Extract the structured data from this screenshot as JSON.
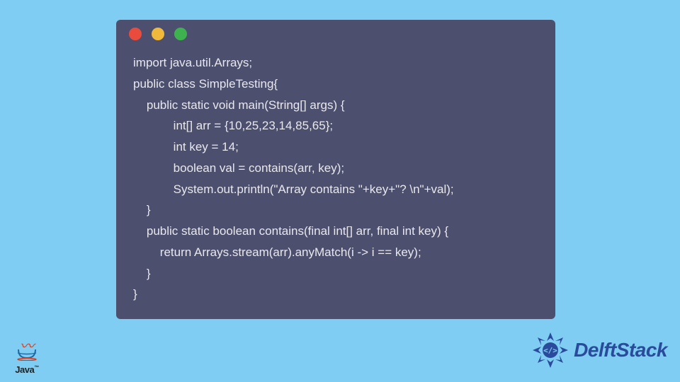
{
  "code": {
    "lines": [
      "import java.util.Arrays;",
      "public class SimpleTesting{",
      "    public static void main(String[] args) {",
      "            int[] arr = {10,25,23,14,85,65};",
      "            int key = 14;",
      "            boolean val = contains(arr, key);",
      "            System.out.println(\"Array contains \"+key+\"? \\n\"+val);",
      "    }",
      "    public static boolean contains(final int[] arr, final int key) {",
      "        return Arrays.stream(arr).anyMatch(i -> i == key);",
      "    }",
      "}"
    ]
  },
  "dots": {
    "red": "#e94b3c",
    "yellow": "#f1b93c",
    "green": "#3fb250"
  },
  "java_logo": {
    "text": "Java",
    "trademark": "™"
  },
  "delft": {
    "text": "DelftStack"
  }
}
